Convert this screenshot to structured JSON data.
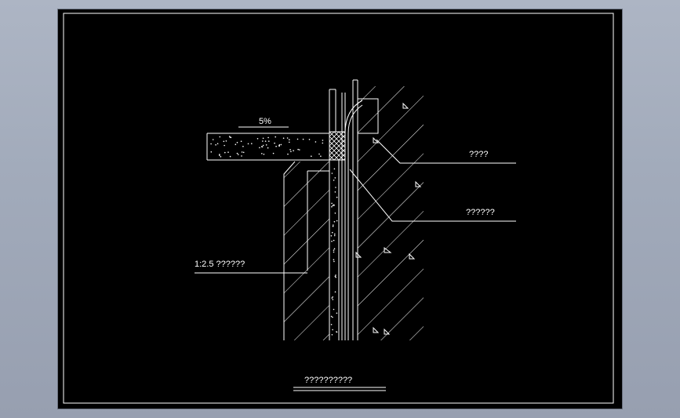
{
  "drawing": {
    "slope_label": "5%",
    "callouts": {
      "top_right": "????",
      "mid_right": "??????",
      "left": "1:2.5  ??????"
    },
    "title": "??????????"
  },
  "colors": {
    "background": "#000000",
    "lines": "#ffffff",
    "window_bg": "#a2abbb"
  }
}
